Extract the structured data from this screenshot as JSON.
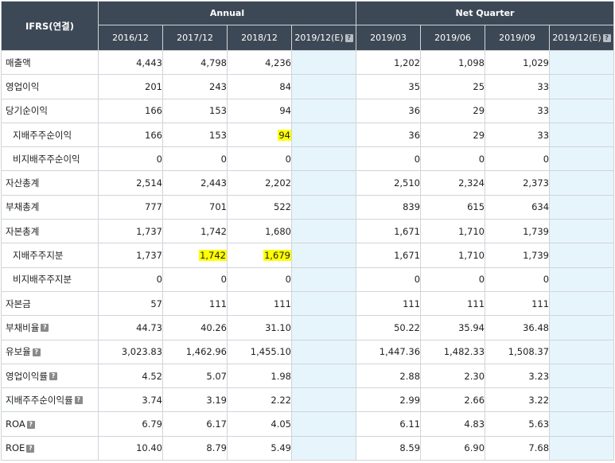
{
  "header": {
    "corner": "IFRS(연결)",
    "annual_label": "Annual",
    "quarter_label": "Net Quarter",
    "annual_periods": [
      "2016/12",
      "2017/12",
      "2018/12",
      "2019/12(E)"
    ],
    "quarter_periods": [
      "2019/03",
      "2019/06",
      "2019/09",
      "2019/12(E)"
    ]
  },
  "rows": [
    {
      "label": "매출액",
      "sub": false,
      "help": false,
      "annual": [
        "4,443",
        "4,798",
        "4,236",
        ""
      ],
      "quarter": [
        "1,202",
        "1,098",
        "1,029",
        ""
      ]
    },
    {
      "label": "영업이익",
      "sub": false,
      "help": false,
      "annual": [
        "201",
        "243",
        "84",
        ""
      ],
      "quarter": [
        "35",
        "25",
        "33",
        ""
      ]
    },
    {
      "label": "당기순이익",
      "sub": false,
      "help": false,
      "annual": [
        "166",
        "153",
        "94",
        ""
      ],
      "quarter": [
        "36",
        "29",
        "33",
        ""
      ]
    },
    {
      "label": "지배주주순이익",
      "sub": true,
      "help": false,
      "annual": [
        "166",
        "153",
        "94",
        ""
      ],
      "quarter": [
        "36",
        "29",
        "33",
        ""
      ]
    },
    {
      "label": "비지배주주순이익",
      "sub": true,
      "help": false,
      "annual": [
        "0",
        "0",
        "0",
        ""
      ],
      "quarter": [
        "0",
        "0",
        "0",
        ""
      ]
    },
    {
      "label": "자산총계",
      "sub": false,
      "help": false,
      "annual": [
        "2,514",
        "2,443",
        "2,202",
        ""
      ],
      "quarter": [
        "2,510",
        "2,324",
        "2,373",
        ""
      ]
    },
    {
      "label": "부채총계",
      "sub": false,
      "help": false,
      "annual": [
        "777",
        "701",
        "522",
        ""
      ],
      "quarter": [
        "839",
        "615",
        "634",
        ""
      ]
    },
    {
      "label": "자본총계",
      "sub": false,
      "help": false,
      "annual": [
        "1,737",
        "1,742",
        "1,680",
        ""
      ],
      "quarter": [
        "1,671",
        "1,710",
        "1,739",
        ""
      ]
    },
    {
      "label": "지배주주지분",
      "sub": true,
      "help": false,
      "annual": [
        "1,737",
        "1,742",
        "1,679",
        ""
      ],
      "quarter": [
        "1,671",
        "1,710",
        "1,739",
        ""
      ]
    },
    {
      "label": "비지배주주지분",
      "sub": true,
      "help": false,
      "annual": [
        "0",
        "0",
        "0",
        ""
      ],
      "quarter": [
        "0",
        "0",
        "0",
        ""
      ]
    },
    {
      "label": "자본금",
      "sub": false,
      "help": false,
      "annual": [
        "57",
        "111",
        "111",
        ""
      ],
      "quarter": [
        "111",
        "111",
        "111",
        ""
      ]
    },
    {
      "label": "부채비율",
      "sub": false,
      "help": true,
      "annual": [
        "44.73",
        "40.26",
        "31.10",
        ""
      ],
      "quarter": [
        "50.22",
        "35.94",
        "36.48",
        ""
      ]
    },
    {
      "label": "유보율",
      "sub": false,
      "help": true,
      "annual": [
        "3,023.83",
        "1,462.96",
        "1,455.10",
        ""
      ],
      "quarter": [
        "1,447.36",
        "1,482.33",
        "1,508.37",
        ""
      ]
    },
    {
      "label": "영업이익률",
      "sub": false,
      "help": true,
      "annual": [
        "4.52",
        "5.07",
        "1.98",
        ""
      ],
      "quarter": [
        "2.88",
        "2.30",
        "3.23",
        ""
      ]
    },
    {
      "label": "지배주주순이익률",
      "sub": false,
      "help": true,
      "annual": [
        "3.74",
        "3.19",
        "2.22",
        ""
      ],
      "quarter": [
        "2.99",
        "2.66",
        "3.22",
        ""
      ]
    },
    {
      "label": "ROA",
      "sub": false,
      "help": true,
      "annual": [
        "6.79",
        "6.17",
        "4.05",
        ""
      ],
      "quarter": [
        "6.11",
        "4.83",
        "5.63",
        ""
      ]
    },
    {
      "label": "ROE",
      "sub": false,
      "help": true,
      "annual": [
        "10.40",
        "8.79",
        "5.49",
        ""
      ],
      "quarter": [
        "8.59",
        "6.90",
        "7.68",
        ""
      ]
    }
  ],
  "highlights": [
    {
      "row": 3,
      "group": "annual",
      "col": 2
    },
    {
      "row": 8,
      "group": "annual",
      "col": 1
    },
    {
      "row": 8,
      "group": "annual",
      "col": 2
    }
  ],
  "colors": {
    "header_bg": "#3d4856",
    "estimate_bg": "#e6f5fb",
    "highlight": "#ffff00"
  },
  "icons": {
    "help": "question-mark-icon"
  }
}
